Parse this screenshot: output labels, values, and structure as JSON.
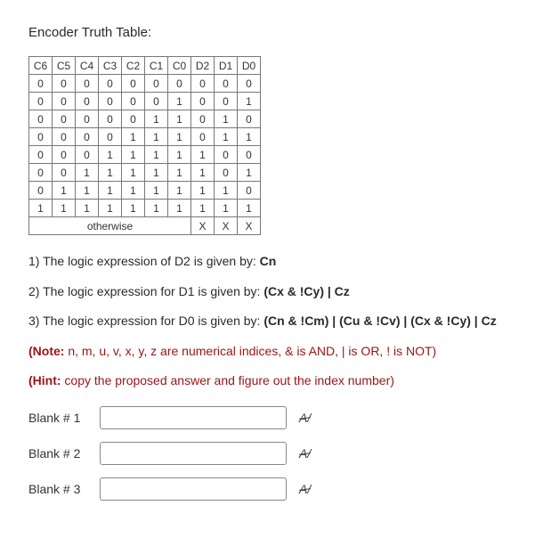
{
  "title": "Encoder Truth Table:",
  "table": {
    "headers": [
      "C6",
      "C5",
      "C4",
      "C3",
      "C2",
      "C1",
      "C0",
      "D2",
      "D1",
      "D0"
    ],
    "rows": [
      [
        "0",
        "0",
        "0",
        "0",
        "0",
        "0",
        "0",
        "0",
        "0",
        "0"
      ],
      [
        "0",
        "0",
        "0",
        "0",
        "0",
        "0",
        "1",
        "0",
        "0",
        "1"
      ],
      [
        "0",
        "0",
        "0",
        "0",
        "0",
        "1",
        "1",
        "0",
        "1",
        "0"
      ],
      [
        "0",
        "0",
        "0",
        "0",
        "1",
        "1",
        "1",
        "0",
        "1",
        "1"
      ],
      [
        "0",
        "0",
        "0",
        "1",
        "1",
        "1",
        "1",
        "1",
        "0",
        "0"
      ],
      [
        "0",
        "0",
        "1",
        "1",
        "1",
        "1",
        "1",
        "1",
        "0",
        "1"
      ],
      [
        "0",
        "1",
        "1",
        "1",
        "1",
        "1",
        "1",
        "1",
        "1",
        "0"
      ],
      [
        "1",
        "1",
        "1",
        "1",
        "1",
        "1",
        "1",
        "1",
        "1",
        "1"
      ]
    ],
    "otherwise_label": "otherwise",
    "otherwise_out": [
      "X",
      "X",
      "X"
    ]
  },
  "q1": {
    "text": "1) The logic expression of D2 is given by: ",
    "bold": "Cn"
  },
  "q2": {
    "text": "2) The logic expression for D1 is given by: ",
    "bold": "(Cx & !Cy) | Cz"
  },
  "q3": {
    "text": "3) The logic expression for D0 is given by: ",
    "bold": "(Cn & !Cm) | (Cu & !Cv) | (Cx & !Cy) | Cz"
  },
  "note": {
    "label": "(Note:",
    "text": " n, m, u, v, x, y, z are numerical indices, & is AND, | is OR, ! is NOT)"
  },
  "hint": {
    "label": "(Hint:",
    "text": " copy the proposed answer and figure out the index number)"
  },
  "blanks": [
    {
      "label": "Blank # 1",
      "value": ""
    },
    {
      "label": "Blank # 2",
      "value": ""
    },
    {
      "label": "Blank # 3",
      "value": ""
    }
  ],
  "check_glyph": "A/"
}
